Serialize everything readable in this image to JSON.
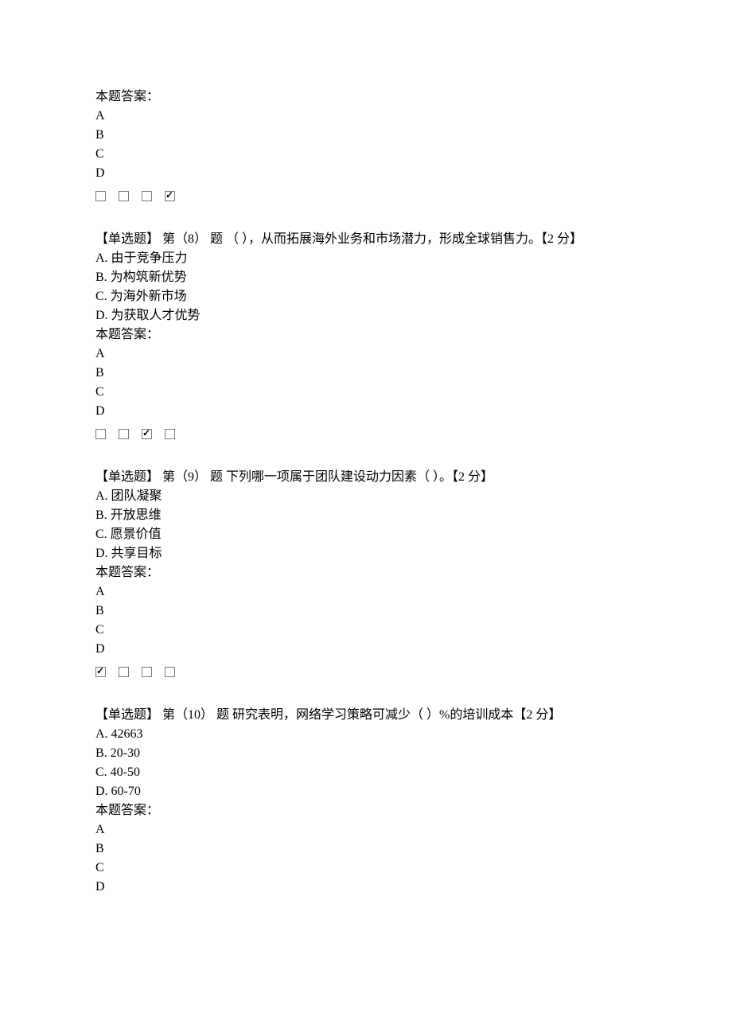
{
  "section_prev": {
    "answer_label": "本题答案：",
    "letters": [
      "A",
      "B",
      "C",
      "D"
    ],
    "checked_index": 3
  },
  "q8": {
    "header": "【单选题】 第（8） 题 （  ），从而拓展海外业务和市场潜力，形成全球销售力。【2 分】",
    "options": [
      "A.  由于竞争压力",
      "B.  为构筑新优势",
      "C.  为海外新市场",
      "D.  为获取人才优势"
    ],
    "answer_label": "本题答案：",
    "letters": [
      "A",
      "B",
      "C",
      "D"
    ],
    "checked_index": 2
  },
  "q9": {
    "header": "【单选题】 第（9） 题  下列哪一项属于团队建设动力因素（  ）。【2 分】",
    "options": [
      "A.  团队凝聚",
      "B.  开放思维",
      "C.  愿景价值",
      "D.  共享目标"
    ],
    "answer_label": "本题答案：",
    "letters": [
      "A",
      "B",
      "C",
      "D"
    ],
    "checked_index": 0
  },
  "q10": {
    "header": "【单选题】 第（10） 题  研究表明，网络学习策略可减少（  ）%的培训成本【2 分】",
    "options": [
      "A. 42663",
      "B. 20-30",
      "C. 40-50",
      "D. 60-70"
    ],
    "answer_label": "本题答案：",
    "letters": [
      "A",
      "B",
      "C",
      "D"
    ]
  }
}
